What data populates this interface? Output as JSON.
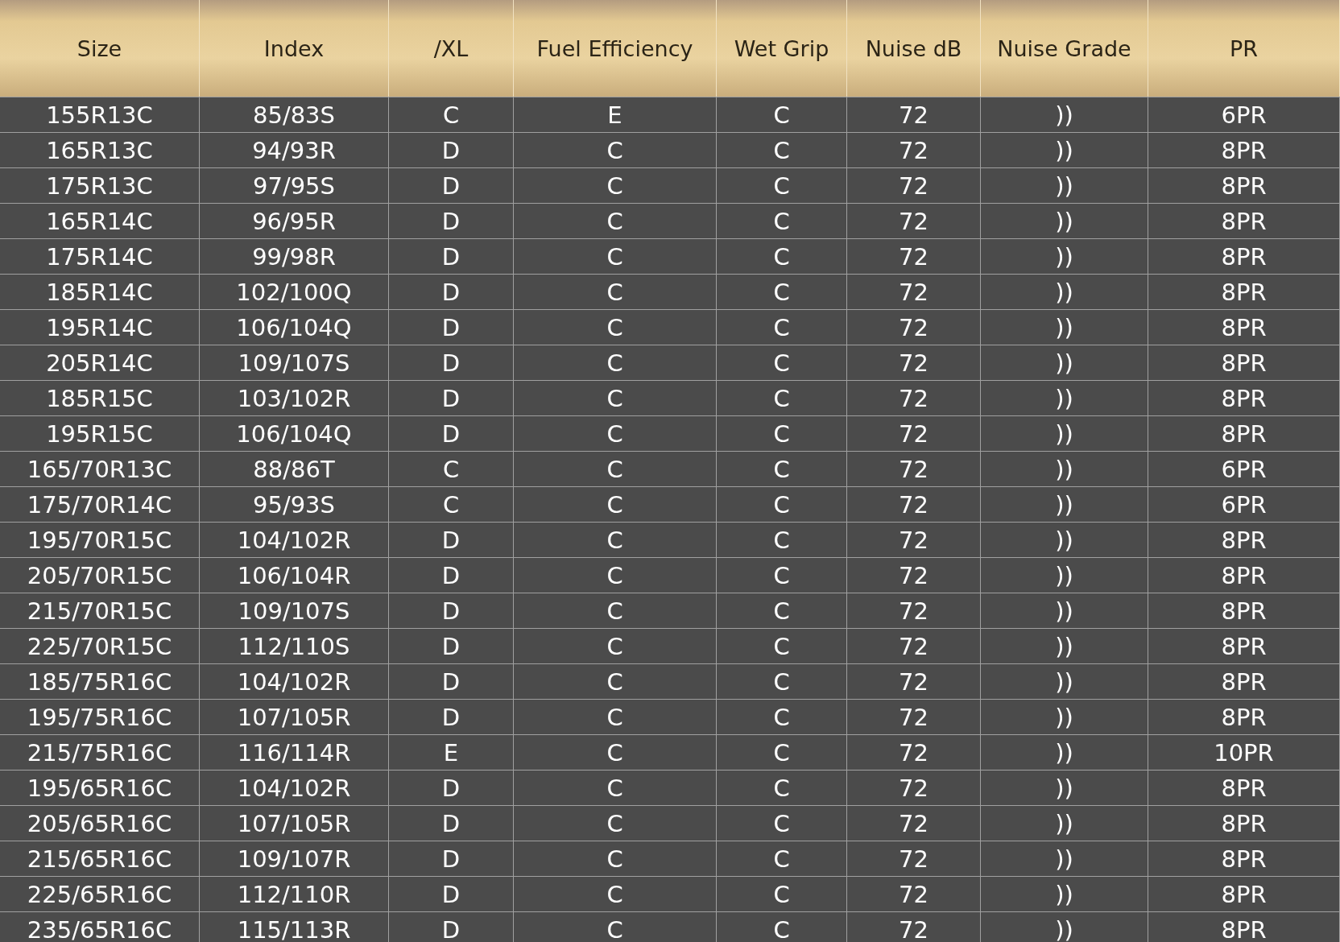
{
  "table": {
    "columns": [
      "Size",
      "Index",
      "/XL",
      "Fuel Efficiency",
      "Wet Grip",
      "Nuise dB",
      "Nuise Grade",
      "PR"
    ],
    "rows": [
      [
        "155R13C",
        "85/83S",
        "C",
        "E",
        "C",
        "72",
        "))",
        "6PR"
      ],
      [
        "165R13C",
        "94/93R",
        "D",
        "C",
        "C",
        "72",
        "))",
        "8PR"
      ],
      [
        "175R13C",
        "97/95S",
        "D",
        "C",
        "C",
        "72",
        "))",
        "8PR"
      ],
      [
        "165R14C",
        "96/95R",
        "D",
        "C",
        "C",
        "72",
        "))",
        "8PR"
      ],
      [
        "175R14C",
        "99/98R",
        "D",
        "C",
        "C",
        "72",
        "))",
        "8PR"
      ],
      [
        "185R14C",
        "102/100Q",
        "D",
        "C",
        "C",
        "72",
        "))",
        "8PR"
      ],
      [
        "195R14C",
        "106/104Q",
        "D",
        "C",
        "C",
        "72",
        "))",
        "8PR"
      ],
      [
        "205R14C",
        "109/107S",
        "D",
        "C",
        "C",
        "72",
        "))",
        "8PR"
      ],
      [
        "185R15C",
        "103/102R",
        "D",
        "C",
        "C",
        "72",
        "))",
        "8PR"
      ],
      [
        "195R15C",
        "106/104Q",
        "D",
        "C",
        "C",
        "72",
        "))",
        "8PR"
      ],
      [
        "165/70R13C",
        "88/86T",
        "C",
        "C",
        "C",
        "72",
        "))",
        "6PR"
      ],
      [
        "175/70R14C",
        "95/93S",
        "C",
        "C",
        "C",
        "72",
        "))",
        "6PR"
      ],
      [
        "195/70R15C",
        "104/102R",
        "D",
        "C",
        "C",
        "72",
        "))",
        "8PR"
      ],
      [
        "205/70R15C",
        "106/104R",
        "D",
        "C",
        "C",
        "72",
        "))",
        "8PR"
      ],
      [
        "215/70R15C",
        "109/107S",
        "D",
        "C",
        "C",
        "72",
        "))",
        "8PR"
      ],
      [
        "225/70R15C",
        "112/110S",
        "D",
        "C",
        "C",
        "72",
        "))",
        "8PR"
      ],
      [
        "185/75R16C",
        "104/102R",
        "D",
        "C",
        "C",
        "72",
        "))",
        "8PR"
      ],
      [
        "195/75R16C",
        "107/105R",
        "D",
        "C",
        "C",
        "72",
        "))",
        "8PR"
      ],
      [
        "215/75R16C",
        "116/114R",
        "E",
        "C",
        "C",
        "72",
        "))",
        "10PR"
      ],
      [
        "195/65R16C",
        "104/102R",
        "D",
        "C",
        "C",
        "72",
        "))",
        "8PR"
      ],
      [
        "205/65R16C",
        "107/105R",
        "D",
        "C",
        "C",
        "72",
        "))",
        "8PR"
      ],
      [
        "215/65R16C",
        "109/107R",
        "D",
        "C",
        "C",
        "72",
        "))",
        "8PR"
      ],
      [
        "225/65R16C",
        "112/110R",
        "D",
        "C",
        "C",
        "72",
        "))",
        "8PR"
      ],
      [
        "235/65R16C",
        "115/113R",
        "D",
        "C",
        "C",
        "72",
        "))",
        "8PR"
      ]
    ]
  }
}
